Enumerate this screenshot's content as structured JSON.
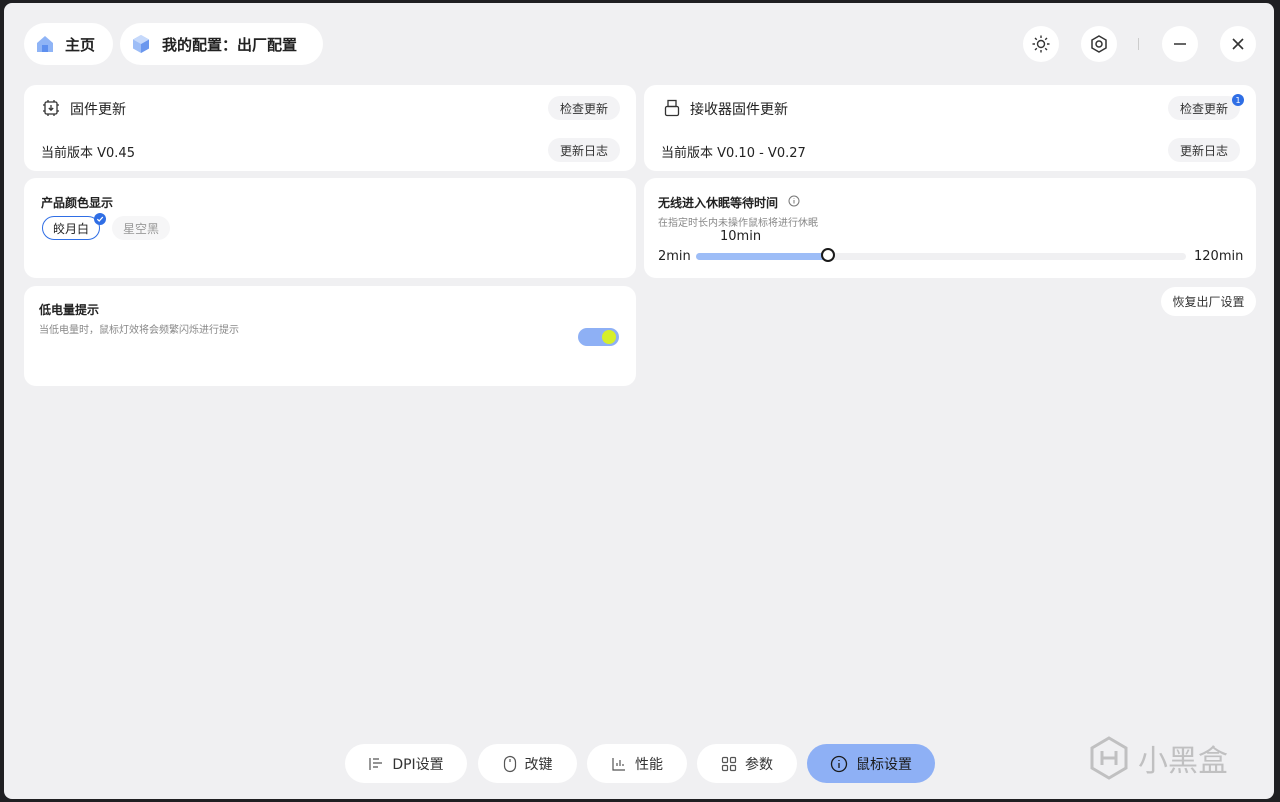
{
  "header": {
    "home_label": "主页",
    "config_label": "我的配置：出厂配置"
  },
  "firmware": {
    "title": "固件更新",
    "check_label": "检查更新",
    "version_text": "当前版本 V0.45",
    "changelog_label": "更新日志"
  },
  "receiver": {
    "title": "接收器固件更新",
    "check_label": "检查更新",
    "badge_count": "1",
    "version_text": "当前版本 V0.10 - V0.27",
    "changelog_label": "更新日志"
  },
  "color_display": {
    "title": "产品颜色显示",
    "options": [
      "皎月白",
      "星空黑"
    ],
    "selected": "皎月白"
  },
  "sleep": {
    "title": "无线进入休眠等待时间",
    "description": "在指定时长内未操作鼠标将进行休眠",
    "current_label": "10min",
    "min_label": "2min",
    "max_label": "120min",
    "min_value": 2,
    "max_value": 120,
    "value": 10
  },
  "low_battery": {
    "title": "低电量提示",
    "description": "当低电量时，鼠标灯效将会频繁闪烁进行提示",
    "enabled": true
  },
  "reset_label": "恢复出厂设置",
  "tabs": [
    {
      "label": "DPI设置",
      "icon": "dpi-icon"
    },
    {
      "label": "改键",
      "icon": "mouse-icon"
    },
    {
      "label": "性能",
      "icon": "performance-icon"
    },
    {
      "label": "参数",
      "icon": "params-icon"
    },
    {
      "label": "鼠标设置",
      "icon": "info-icon",
      "active": true
    }
  ],
  "watermark": "小黑盒",
  "colors": {
    "accent": "#8eb0f5",
    "selected_border": "#2f6ee5",
    "toggle_knob": "#d6ef2a"
  }
}
